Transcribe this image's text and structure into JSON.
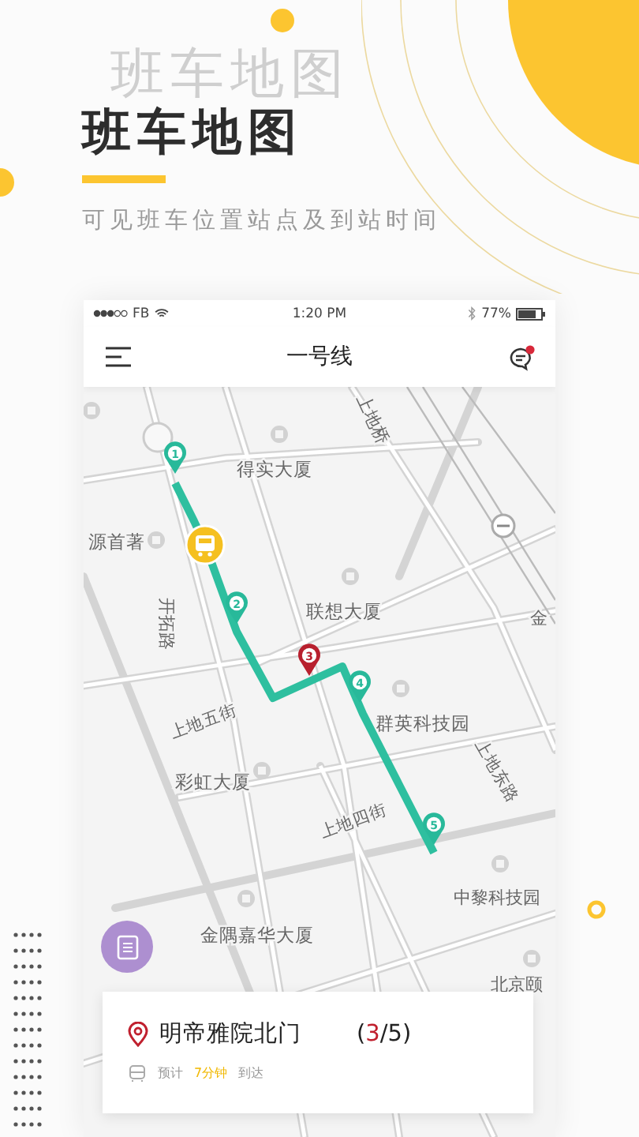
{
  "promo": {
    "ghost_title": "班车地图",
    "title": "班车地图",
    "subtitle": "可见班车位置站点及到站时间"
  },
  "status_bar": {
    "carrier": "FB",
    "time": "1:20 PM",
    "battery": "77%"
  },
  "nav": {
    "title": "一号线",
    "unread": true
  },
  "map": {
    "labels": [
      "上地桥",
      "得实大厦",
      "源首著",
      "联想大厦",
      "开拓路",
      "金",
      "上地五街",
      "群英科技园",
      "彩虹大厦",
      "上地四街",
      "上地东路",
      "中黎科技园",
      "金隅嘉华大厦",
      "北京颐"
    ],
    "stops": [
      {
        "label": "1",
        "selected": false
      },
      {
        "label": "2",
        "selected": false
      },
      {
        "label": "3",
        "selected": true
      },
      {
        "label": "4",
        "selected": false
      },
      {
        "label": "5",
        "selected": false
      }
    ]
  },
  "card": {
    "station": "明帝雅院北门",
    "progress": {
      "prefix": "(",
      "current": "3",
      "suffix": "/5)",
      "highlight": true
    },
    "eta_prefix": "预计",
    "eta": "7分钟",
    "eta_suffix": "到达"
  }
}
